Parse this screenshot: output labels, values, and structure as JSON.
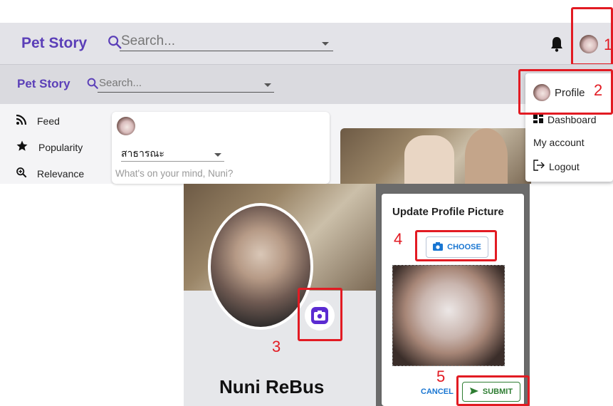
{
  "app": {
    "title": "Pet Story"
  },
  "header_large": {
    "brand": "Pet Story",
    "search_placeholder": "Search..."
  },
  "header_small": {
    "brand": "Pet Story",
    "search_placeholder": "Search..."
  },
  "sidebar": {
    "items": [
      {
        "label": "Feed",
        "icon": "rss-icon"
      },
      {
        "label": "Popularity",
        "icon": "star-icon"
      },
      {
        "label": "Relevance",
        "icon": "zoom-icon"
      }
    ]
  },
  "composer": {
    "visibility": "สาธารณะ",
    "placeholder": "What's on your mind, Nuni?"
  },
  "user_menu": {
    "items": [
      {
        "label": "Profile",
        "icon": "avatar"
      },
      {
        "label": "Dashboard",
        "icon": "dashboard-icon"
      },
      {
        "label": "My account",
        "icon": ""
      },
      {
        "label": "Logout",
        "icon": "logout-icon"
      }
    ]
  },
  "profile": {
    "name": "Nuni ReBus"
  },
  "dialog": {
    "title": "Update Profile Picture",
    "choose_label": "CHOOSE",
    "cancel_label": "CANCEL",
    "submit_label": "SUBMIT"
  },
  "steps": [
    "1",
    "2",
    "3",
    "4",
    "5"
  ],
  "colors": {
    "brand": "#5b3fb8",
    "annotation": "#e21b23",
    "primary": "#1976d2",
    "success": "#2e7d32",
    "camera_button": "#5b2bd1"
  }
}
